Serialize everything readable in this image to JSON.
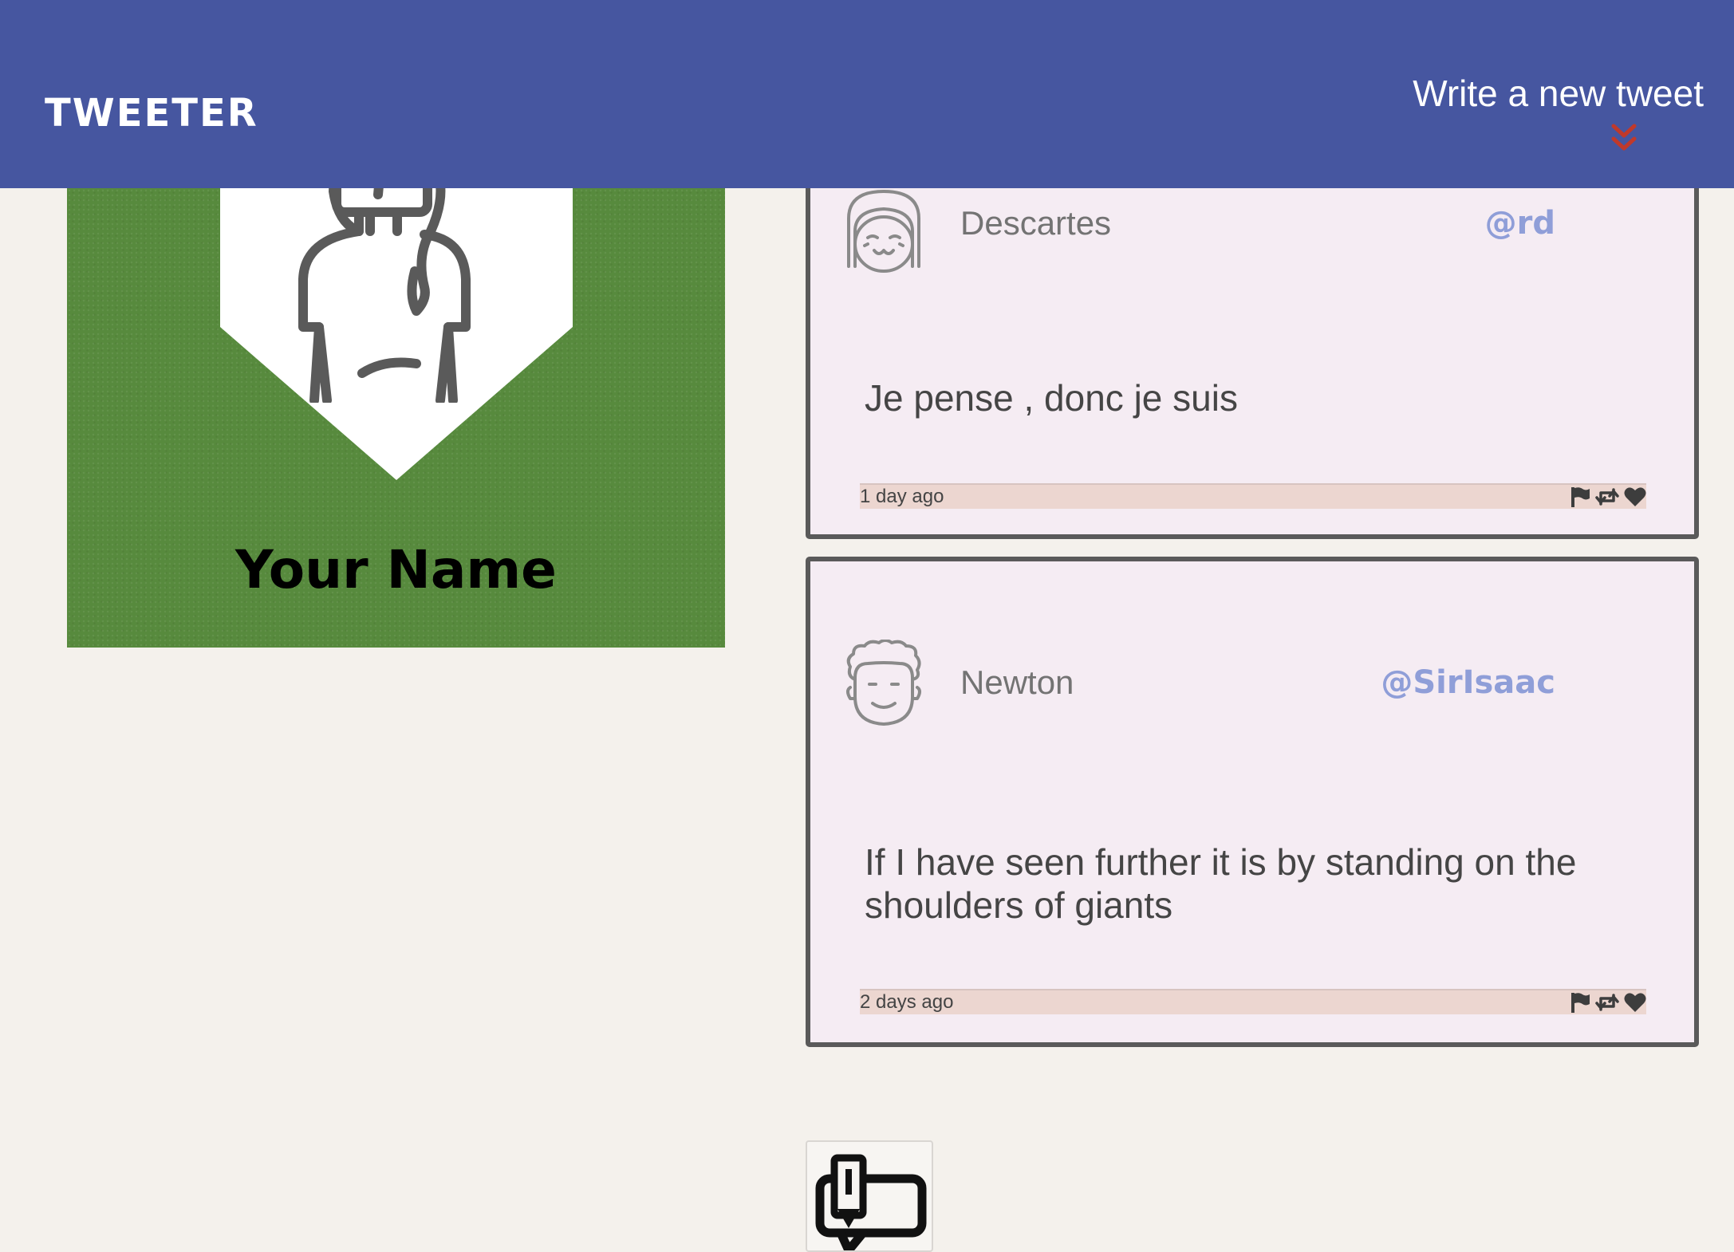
{
  "nav": {
    "brand": "TWEETER",
    "compose_label": "Write a new tweet",
    "compose_icon": "double-chevron-down-icon",
    "background_color": "#4656a0",
    "accent_color": "#c0392b"
  },
  "profile": {
    "name": "Your Name",
    "avatar_icon": "woman-avatar-icon",
    "background_color": "#578a3d"
  },
  "tweets": [
    {
      "author": "Descartes",
      "handle": "@rd",
      "avatar_icon": "girl-avatar-icon",
      "text": "Je pense , donc je suis",
      "time": "1 day ago",
      "actions": [
        "flag-icon",
        "retweet-icon",
        "heart-icon"
      ]
    },
    {
      "author": "Newton",
      "handle": "@SirIsaac",
      "avatar_icon": "curly-hair-avatar-icon",
      "text": "If I have seen further it is by standing on the shoulders of giants",
      "time": "2 days ago",
      "actions": [
        "flag-icon",
        "retweet-icon",
        "heart-icon"
      ]
    }
  ],
  "compose_button": {
    "icon": "write-tweet-icon"
  },
  "colors": {
    "page_background": "#f4f1ec",
    "tweet_background": "#f5ecf3",
    "tweet_border": "#5a5a5a",
    "handle": "#8f9ed8",
    "footer_background": "#ecd6d0"
  }
}
